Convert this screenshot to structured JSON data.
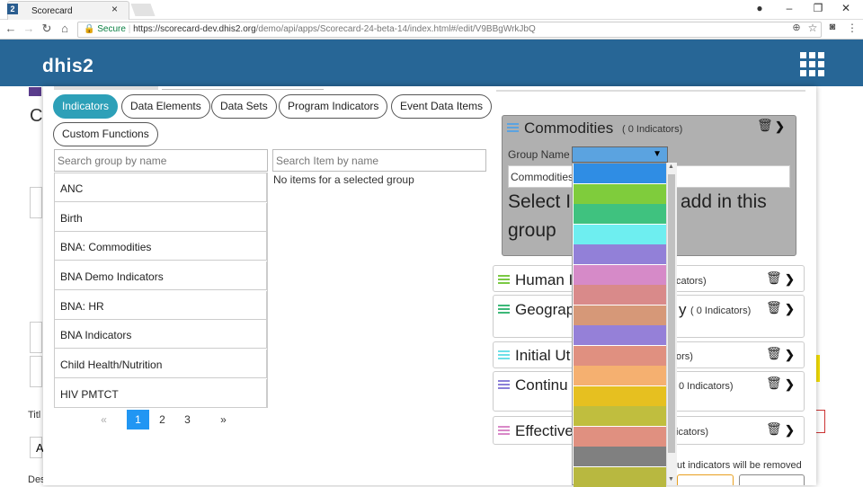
{
  "browser": {
    "tab_title": "Scorecard",
    "tab_favicon": "2",
    "secure_label": "Secure",
    "url_host": "https://scorecard-dev.dhis2.org",
    "url_path": "/demo/api/apps/Scorecard-24-beta-14/index.html#/edit/V9BBgWrkJbQ",
    "window_controls": [
      "minimize-icon",
      "maximize-icon",
      "close-icon"
    ]
  },
  "header": {
    "logo": "dhis2",
    "apps_icon": "apps-grid-icon",
    "color": "#276696"
  },
  "tabs": [
    "Indicators",
    "Data Elements",
    "Data Sets",
    "Program Indicators",
    "Event Data Items",
    "Custom Functions"
  ],
  "active_tab": "Indicators",
  "left": {
    "group_search_placeholder": "Search group by name",
    "item_search_placeholder": "Search Item by name",
    "empty_message": "No items for a selected group",
    "groups": [
      "ANC",
      "Birth",
      "BNA: Commodities",
      "BNA Demo Indicators",
      "BNA: HR",
      "BNA Indicators",
      "Child Health/Nutrition",
      "HIV PMTCT"
    ],
    "pagination": {
      "prev": "«",
      "pages": [
        "1",
        "2",
        "3"
      ],
      "current": "1",
      "next": "»"
    }
  },
  "commodities": {
    "title": "Commodities",
    "count": "( 0 Indicators)",
    "group_name_label": "Group Name",
    "group_name_value": "Commodities",
    "hint_part1": "Select I",
    "hint_part2": "add in this",
    "hint_part3": "group",
    "grip_color": "#5ba3e0"
  },
  "groups": [
    {
      "title": "Human I",
      "count": "cators)",
      "grip_color": "#7ac943"
    },
    {
      "title": "Geograp",
      "count": "y",
      "count_small": "( 0 Indicators)",
      "grip_color": "#3cb878"
    },
    {
      "title": "Initial Ut",
      "count": "ors)",
      "grip_color": "#6ee0e8"
    },
    {
      "title": "Continu",
      "count": "0 Indicators)",
      "grip_color": "#8b7fd8"
    },
    {
      "title": "Effective",
      "count": "icators)",
      "grip_color": "#d989c8"
    }
  ],
  "footer_note": "ut indicators will be removed",
  "color_swatches": [
    "#2f8de4",
    "#7fcc3c",
    "#3fc27f",
    "#6eeef0",
    "#9280d8",
    "#d68ac8",
    "#d98a8a",
    "#d69878",
    "#9580d8",
    "#e09080",
    "#f5b070",
    "#e6c020",
    "#c0be3e",
    "#e09080",
    "#808080",
    "#b8b840"
  ]
}
